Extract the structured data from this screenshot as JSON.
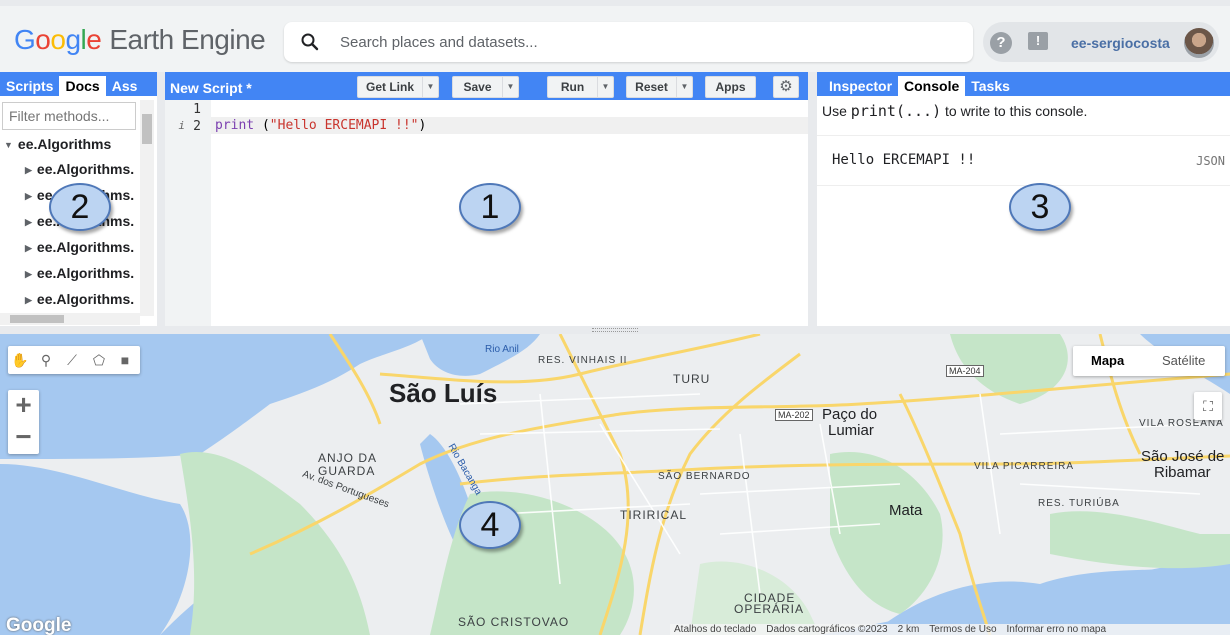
{
  "app": {
    "logo_google": [
      "G",
      "o",
      "o",
      "g",
      "l",
      "e"
    ],
    "logo_product": "Earth Engine",
    "search_placeholder": "Search places and datasets...",
    "help_glyph": "?",
    "feedback_glyph": "!",
    "username": "ee-sergiocosta"
  },
  "left_panel": {
    "tabs": [
      "Scripts",
      "Docs",
      "Ass"
    ],
    "active_tab": "Docs",
    "filter_placeholder": "Filter methods...",
    "tree_root": "ee.Algorithms",
    "tree_items": [
      "ee.Algorithms.",
      "ee.Algorithms.",
      "ee.Algorithms.",
      "ee.Algorithms.",
      "ee.Algorithms.",
      "ee.Algorithms."
    ]
  },
  "editor": {
    "title": "New Script *",
    "buttons": {
      "get_link": "Get Link",
      "save": "Save",
      "run": "Run",
      "reset": "Reset",
      "apps": "Apps"
    },
    "line_numbers": [
      "1",
      "2"
    ],
    "line_marker": "i",
    "code": {
      "keyword": "print",
      "open": " (",
      "string": "\"Hello ERCEMAPI !!\"",
      "close": ")"
    }
  },
  "right_panel": {
    "tabs": [
      "Inspector",
      "Console",
      "Tasks"
    ],
    "active_tab": "Console",
    "hint_prefix": "Use ",
    "hint_code": "print(...)",
    "hint_suffix": " to write to this console.",
    "output": "Hello ERCEMAPI !!",
    "output_type": "JSON"
  },
  "map": {
    "map_types": [
      "Mapa",
      "Satélite"
    ],
    "active_map_type": "Mapa",
    "zoom_in": "+",
    "zoom_out": "−",
    "labels": {
      "city": "São Luís",
      "rio_anil": "Rio Anil",
      "res_vinhais": "RES. VINHAIS II",
      "turu": "TURU",
      "paco": "Paço do",
      "lumiar": "Lumiar",
      "anjo1": "ANJO DA",
      "anjo2": "GUARDA",
      "av_port": "Av. dos Portugueses",
      "rio_bacanga": "Rio Bacanga",
      "sao_bernardo": "SÃO BERNARDO",
      "tirirical": "TIRIRICAL",
      "mata": "Mata",
      "vila_rosena": "VILA ROSEANA",
      "vila_picarreira": "VILA PICARREIRA",
      "sao_jose1": "São José de",
      "sao_jose2": "Ribamar",
      "res_turiuba": "RES. TURIÚBA",
      "cidade1": "CIDADE",
      "cidade2": "OPERÁRIA",
      "sao_cristovao": "SÃO CRISTOVAO",
      "ma202": "MA-202",
      "ma204": "MA-204"
    },
    "google": "Google",
    "attribution": [
      "Atalhos do teclado",
      "Dados cartográficos ©2023",
      "2 km",
      "Termos de Uso",
      "Informar erro no mapa"
    ]
  },
  "callouts": [
    "1",
    "2",
    "3",
    "4"
  ],
  "colors": {
    "accent_blue": "#4285f4",
    "water": "#a5c8f0",
    "park": "#c5e5c8",
    "road": "#f9d66b"
  }
}
